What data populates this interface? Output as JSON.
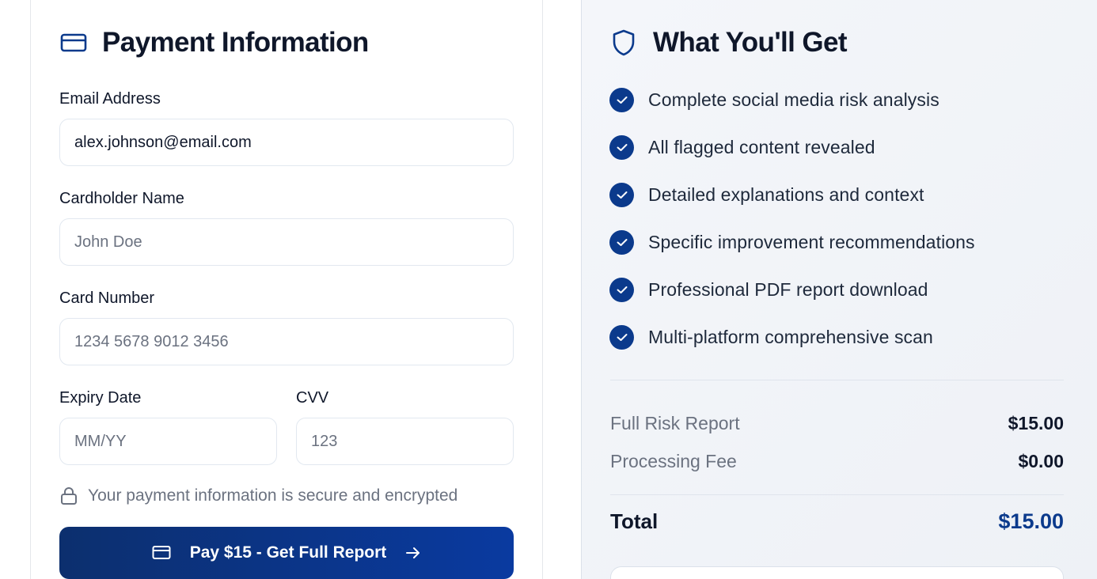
{
  "payment": {
    "title": "Payment Information",
    "email": {
      "label": "Email Address",
      "value": "alex.johnson@email.com"
    },
    "cardholder": {
      "label": "Cardholder Name",
      "placeholder": "John Doe"
    },
    "card_number": {
      "label": "Card Number",
      "placeholder": "1234 5678 9012 3456"
    },
    "expiry": {
      "label": "Expiry Date",
      "placeholder": "MM/YY"
    },
    "cvv": {
      "label": "CVV",
      "placeholder": "123"
    },
    "secure_note": "Your payment information is secure and encrypted",
    "pay_button_label": "Pay $15 - Get Full Report"
  },
  "benefits": {
    "title": "What You'll Get",
    "items": [
      "Complete social media risk analysis",
      "All flagged content revealed",
      "Detailed explanations and context",
      "Specific improvement recommendations",
      "Professional PDF report download",
      "Multi-platform comprehensive scan"
    ]
  },
  "summary": {
    "full_report": {
      "label": "Full Risk Report",
      "value": "$15.00"
    },
    "processing_fee": {
      "label": "Processing Fee",
      "value": "$0.00"
    },
    "total": {
      "label": "Total",
      "value": "$15.00"
    }
  },
  "icons": {
    "title_icon": "credit-card-icon",
    "shield_icon": "shield-icon",
    "check_icon": "check-circle-icon",
    "lock_icon": "lock-icon",
    "arrow_icon": "arrow-right-icon"
  },
  "colors": {
    "brand": "#0b3a8c",
    "button_gradient_start": "#0c2f6e",
    "button_gradient_end": "#0a3aa0"
  }
}
